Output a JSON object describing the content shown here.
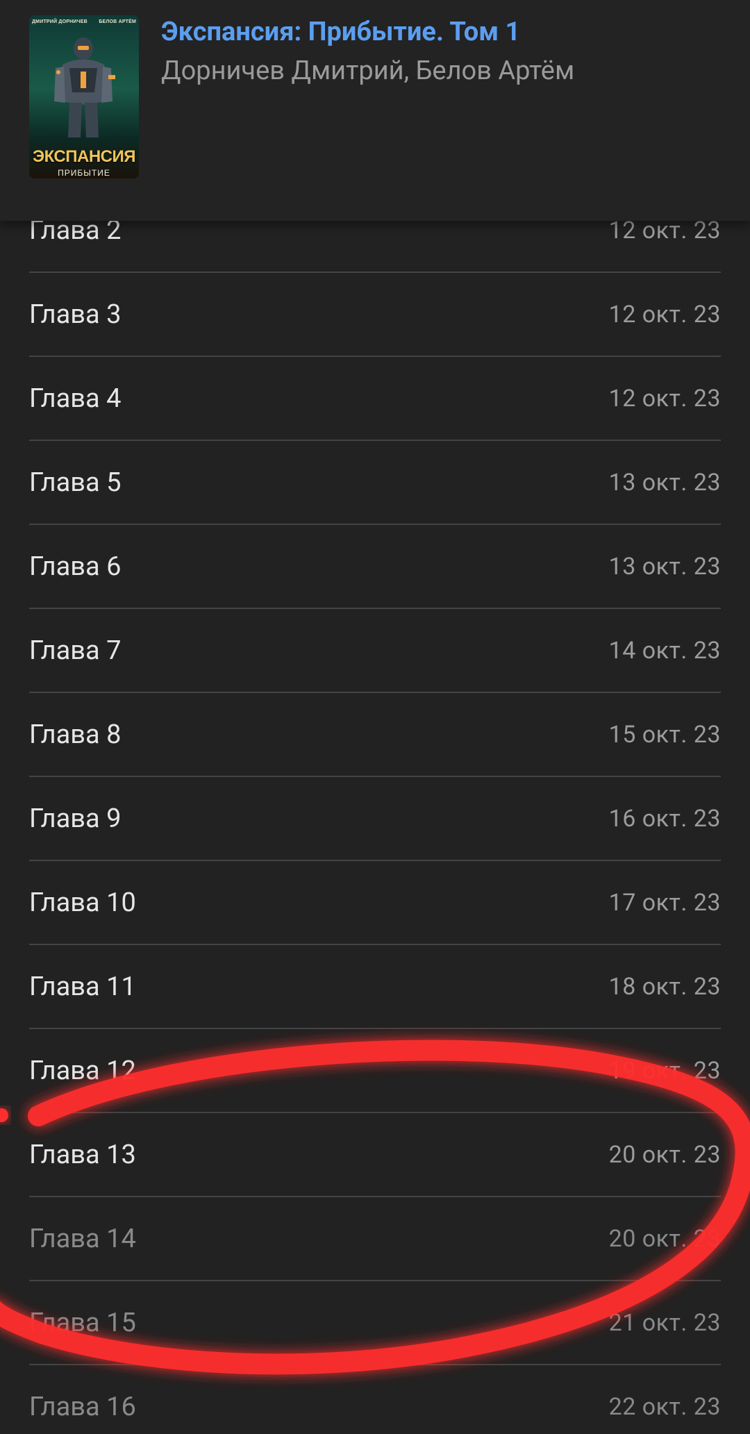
{
  "book": {
    "title": "Экспансия: Прибытие. Том 1",
    "authors": "Дорничев Дмитрий, Белов Артём",
    "cover": {
      "author_left": "ДМИТРИЙ ДОРНИЧЕВ",
      "author_right": "БЕЛОВ АРТЁМ",
      "title_line1": "ЭКСПАНСИЯ",
      "title_line2": "ПРИБЫТИЕ"
    }
  },
  "chapters": [
    {
      "name": "Глава 2",
      "date": "12 окт. 23"
    },
    {
      "name": "Глава 3",
      "date": "12 окт. 23"
    },
    {
      "name": "Глава 4",
      "date": "12 окт. 23"
    },
    {
      "name": "Глава 5",
      "date": "13 окт. 23"
    },
    {
      "name": "Глава 6",
      "date": "13 окт. 23"
    },
    {
      "name": "Глава 7",
      "date": "14 окт. 23"
    },
    {
      "name": "Глава 8",
      "date": "15 окт. 23"
    },
    {
      "name": "Глава 9",
      "date": "16 окт. 23"
    },
    {
      "name": "Глава 10",
      "date": "17 окт. 23"
    },
    {
      "name": "Глава 11",
      "date": "18 окт. 23"
    },
    {
      "name": "Глава 12",
      "date": "19 окт. 23"
    },
    {
      "name": "Глава 13",
      "date": "20 окт. 23"
    },
    {
      "name": "Глава 14",
      "date": "20 окт. 23"
    },
    {
      "name": "Глава 15",
      "date": "21 окт. 23"
    },
    {
      "name": "Глава 16",
      "date": "22 окт. 23"
    }
  ],
  "dimmed_rows": [
    12,
    13,
    14
  ],
  "colors": {
    "background": "#222222",
    "title": "#5b9ef0",
    "annotation": "#ff2e2e"
  }
}
